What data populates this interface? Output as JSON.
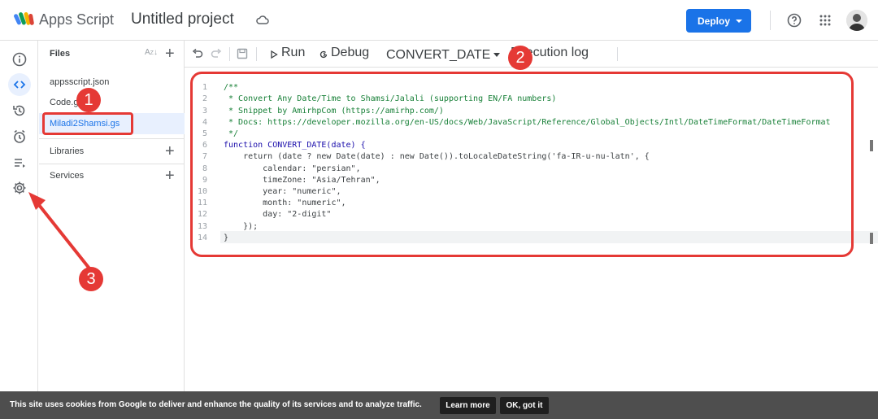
{
  "header": {
    "app_name": "Apps Script",
    "project_title": "Untitled project",
    "deploy_label": "Deploy"
  },
  "rail": {
    "items": [
      "overview-icon",
      "editor-icon",
      "triggers-history-icon",
      "triggers-icon",
      "executions-icon",
      "settings-icon"
    ]
  },
  "files_panel": {
    "title": "Files",
    "files": [
      "appsscript.json",
      "Code.gs",
      "Miladi2Shamsi.gs"
    ],
    "selected_file": "Miladi2Shamsi.gs",
    "libraries_label": "Libraries",
    "services_label": "Services"
  },
  "toolbar": {
    "run_label": "Run",
    "debug_label": "Debug",
    "function_name": "CONVERT_DATE",
    "execution_log_label": "Execution log"
  },
  "editor": {
    "line_numbers": [
      "1",
      "2",
      "3",
      "4",
      "5",
      "6",
      "7",
      "8",
      "9",
      "10",
      "11",
      "12",
      "13",
      "14"
    ],
    "lines": [
      "/**",
      " * Convert Any Date/Time to Shamsi/Jalali (supporting EN/FA numbers)",
      " * Snippet by AmirhpCom (https://amirhp.com/)",
      " * Docs: https://developer.mozilla.org/en-US/docs/Web/JavaScript/Reference/Global_Objects/Intl/DateTimeFormat/DateTimeFormat",
      " */",
      "function CONVERT_DATE(date) {",
      "    return (date ? new Date(date) : new Date()).toLocaleDateString('fa-IR-u-nu-latn', {",
      "        calendar: \"persian\",",
      "        timeZone: \"Asia/Tehran\",",
      "        year: \"numeric\",",
      "        month: \"numeric\",",
      "        day: \"2-digit\"",
      "    });",
      "}"
    ]
  },
  "annotations": {
    "badge_1": "1",
    "badge_2": "2",
    "badge_3": "3"
  },
  "cookie_bar": {
    "text": "This site uses cookies from Google to deliver and enhance the quality of its services and to analyze traffic.",
    "learn_more": "Learn more",
    "ok": "OK, got it"
  },
  "colors": {
    "accent": "#1a73e8",
    "annotation": "#e53935",
    "cookie_bg": "#4e4e4e"
  }
}
